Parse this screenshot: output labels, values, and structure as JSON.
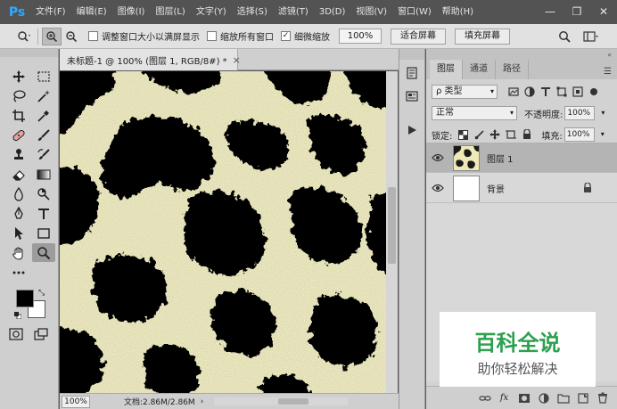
{
  "app": {
    "logo": "Ps",
    "menu": [
      "文件(F)",
      "编辑(E)",
      "图像(I)",
      "图层(L)",
      "文字(Y)",
      "选择(S)",
      "滤镜(T)",
      "3D(D)",
      "视图(V)",
      "窗口(W)",
      "帮助(H)"
    ],
    "window_controls": {
      "minimize": "—",
      "restore": "❐",
      "close": "✕"
    }
  },
  "options_bar": {
    "checkbox_resize_windows": {
      "label": "调整窗口大小以满屏显示",
      "checked": false
    },
    "checkbox_zoom_all": {
      "label": "缩放所有窗口",
      "checked": false
    },
    "checkbox_scrubby_zoom": {
      "label": "细微缩放",
      "checked": true
    },
    "zoom_value": "100%",
    "fit_screen_button": "适合屏幕",
    "fill_screen_button": "填充屏幕"
  },
  "document": {
    "tab_title": "未标题-1 @ 100% (图层 1, RGB/8#) *",
    "tab_close": "×",
    "status_zoom": "100%",
    "status_info": "文档:2.86M/2.86M",
    "status_arrow": "›",
    "canvas_colors": {
      "light": "#f4f1c8",
      "dark": "#000000"
    }
  },
  "layers_panel": {
    "tabs": [
      "图层",
      "通道",
      "路径"
    ],
    "active_tab": "图层",
    "filter_kind": "ρ 类型",
    "blend_mode": "正常",
    "opacity_label": "不透明度:",
    "opacity_value": "100%",
    "lock_label": "锁定:",
    "fill_label": "填充:",
    "fill_value": "100%",
    "layers": [
      {
        "name": "图层 1",
        "visible": true,
        "selected": true,
        "thumbnail": "noise-pattern"
      },
      {
        "name": "背景",
        "visible": true,
        "selected": false,
        "thumbnail": "white",
        "locked": true
      }
    ]
  },
  "watermark": {
    "title": "百科全说",
    "subtitle": "助你轻松解决"
  }
}
